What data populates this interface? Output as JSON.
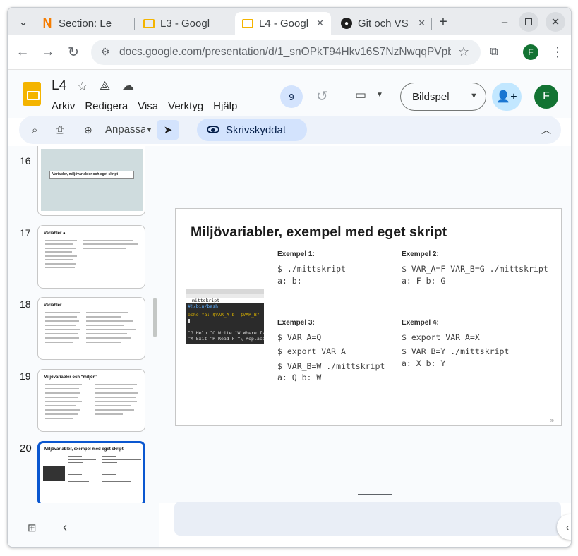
{
  "browser": {
    "tabs": [
      {
        "title": "Section: Le",
        "favicon": "n-icon",
        "active": false
      },
      {
        "title": "L3 - Googl",
        "favicon": "google-slides-icon",
        "active": false
      },
      {
        "title": "L4 - Googl",
        "favicon": "google-slides-icon",
        "active": true
      },
      {
        "title": "Git och VS",
        "favicon": "github-icon",
        "active": false
      }
    ],
    "new_tab": "+",
    "url": "docs.google.com/presentation/d/1_snOPkT94Hkv16S7NzNwqqPVpb7J…",
    "profile_initial": "F"
  },
  "docs": {
    "title": "L4",
    "menu": [
      "Arkiv",
      "Redigera",
      "Visa",
      "Verktyg",
      "Hjälp"
    ],
    "collaborators_count": "9",
    "present_label": "Bildspel",
    "account_initial": "F",
    "toolbar": {
      "zoom_label": "Anpassa",
      "readonly_label": "Skrivskyddat"
    }
  },
  "filmstrip": {
    "slides": [
      {
        "number": "16",
        "title": "Variabler, miljövariabler och eget skript"
      },
      {
        "number": "17",
        "title": "Variabler ●"
      },
      {
        "number": "18",
        "title": "Variabler"
      },
      {
        "number": "19",
        "title": "Miljövariabler och \"miljön\""
      },
      {
        "number": "20",
        "title": "Miljövariabler, exempel med eget skript",
        "selected": true
      }
    ]
  },
  "slide": {
    "title": "Miljövariabler, exempel med eget skript",
    "examples": [
      {
        "label": "Exempel 1:",
        "lines": [
          "$ ./mittskript",
          "a:  b:"
        ]
      },
      {
        "label": "Exempel 2:",
        "lines": [
          "$ VAR_A=F VAR_B=G ./mittskript",
          "a: F b: G"
        ]
      },
      {
        "label": "Exempel 3:",
        "lines": [
          "$ VAR_A=Q",
          "$ export VAR_A",
          "$ VAR_B=W ./mittskript",
          "a: Q b: W"
        ]
      },
      {
        "label": "Exempel 4:",
        "lines": [
          "$ export VAR_A=X",
          "$ VAR_B=Y ./mittskript",
          "a: X b: Y"
        ]
      }
    ],
    "terminal": {
      "filename": "mittskript",
      "shebang": "#!/bin/bash",
      "echo_line": "echo \"a: $VAR_A b: $VAR_B\"",
      "help_row": "^G Help  ^O Write  ^W Where Is",
      "exit_row": "^X Exit  ^R Read F ^\\ Replace"
    },
    "page_number": "20"
  },
  "colors": {
    "accent": "#0b57d0",
    "slides_yellow": "#f4b400",
    "avatar_green": "#137333"
  }
}
